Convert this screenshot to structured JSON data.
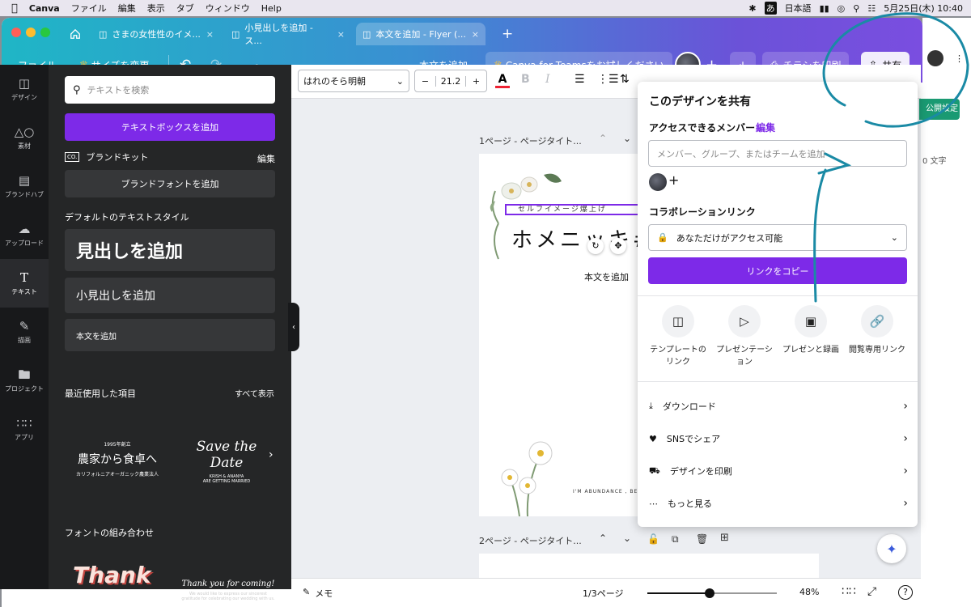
{
  "menubar": {
    "apple": "",
    "app": "Canva",
    "items": [
      "ファイル",
      "編集",
      "表示",
      "タブ",
      "ウィンドウ",
      "Help"
    ],
    "ime_icon": "あ",
    "ime_label": "日本語",
    "datetime": "5月25日(木) 10:40"
  },
  "tabs": [
    {
      "label": "さまの女性性のイメ..."
    },
    {
      "label": "小見出しを追加 - ス..."
    },
    {
      "label": "本文を追加 - Flyer (..."
    }
  ],
  "toolbar": {
    "file": "ファイル",
    "resize": "サイズを変更",
    "doc_title": "本文を追加",
    "teams": "Canva for Teamsをお試しください",
    "print": "チラシを印刷",
    "share": "共有"
  },
  "rail": [
    {
      "label": "デザイン",
      "icon": "layout-icon"
    },
    {
      "label": "素材",
      "icon": "shapes-icon"
    },
    {
      "label": "ブランドハブ",
      "icon": "brand-icon"
    },
    {
      "label": "アップロード",
      "icon": "upload-icon"
    },
    {
      "label": "テキスト",
      "icon": "text-icon"
    },
    {
      "label": "描画",
      "icon": "draw-icon"
    },
    {
      "label": "プロジェクト",
      "icon": "folder-icon"
    },
    {
      "label": "アプリ",
      "icon": "apps-icon"
    }
  ],
  "panel": {
    "search_placeholder": "テキストを検索",
    "add_textbox": "テキストボックスを追加",
    "brand_kit": "ブランドキット",
    "brand_edit": "編集",
    "add_brand_font": "ブランドフォントを追加",
    "default_styles": "デフォルトのテキストスタイル",
    "heading": "見出しを追加",
    "subheading": "小見出しを追加",
    "body": "本文を追加",
    "recent": "最近使用した項目",
    "show_all": "すべて表示",
    "recent1_small": "1995年創立",
    "recent1_big": "農家から食卓へ",
    "recent1_sub": "カリフォルニアオーガニック農業法人",
    "recent2_big": "Save the Date",
    "recent2_sub1": "KRISH & ANANYA",
    "recent2_sub2": "ARE GETTING MARRIED",
    "font_combo": "フォントの組み合わせ",
    "combo1": "Thank you!",
    "combo2": "Thank you for coming!",
    "combo2_sub": "We would like to express our sincerest gratitude for celebrating our wedding with us."
  },
  "format": {
    "font": "はれのそら明朝",
    "minus": "−",
    "size": "21.2",
    "plus": "+",
    "color_letter": "A",
    "bold": "B",
    "italic": "I"
  },
  "canvas": {
    "page1_label": "1ページ - ページタイト...",
    "tagline": "セルフイメージ爆上げ",
    "title_text": "ホメニッキ#",
    "body_text": "本文を追加",
    "footer_text": "I'M ABUNDANCE , BE THE O",
    "page2_label": "2ページ - ページタイト..."
  },
  "bottom": {
    "memo": "メモ",
    "pages": "1/3ページ",
    "zoom": "48%",
    "zoom_level": 0.48
  },
  "share": {
    "title": "このデザインを共有",
    "members": "アクセスできるメンバー",
    "edit": "編集",
    "placeholder": "メンバー、グループ、またはチームを追加",
    "collab": "コラボレーションリンク",
    "access": "あなただけがアクセス可能",
    "copy": "リンクをコピー",
    "opts": [
      {
        "l1": "テンプレートの",
        "l2": "リンク",
        "icon": "template-icon"
      },
      {
        "l1": "プレゼンテーシ",
        "l2": "ョン",
        "icon": "present-icon"
      },
      {
        "l1": "プレゼンと録画",
        "l2": "",
        "icon": "video-icon"
      },
      {
        "l1": "閲覧専用リンク",
        "l2": "",
        "icon": "link-icon"
      }
    ],
    "rows": [
      {
        "label": "ダウンロード",
        "icon": "download-icon"
      },
      {
        "label": "SNSでシェア",
        "icon": "heart-icon"
      },
      {
        "label": "デザインを印刷",
        "icon": "truck-icon"
      },
      {
        "label": "もっと見る",
        "icon": "more-icon"
      }
    ]
  },
  "right": {
    "publish": "公開設定",
    "chars": "0 文字"
  },
  "colors": {
    "accent": "#7d2ae8",
    "annotation": "#1a8aa5"
  }
}
